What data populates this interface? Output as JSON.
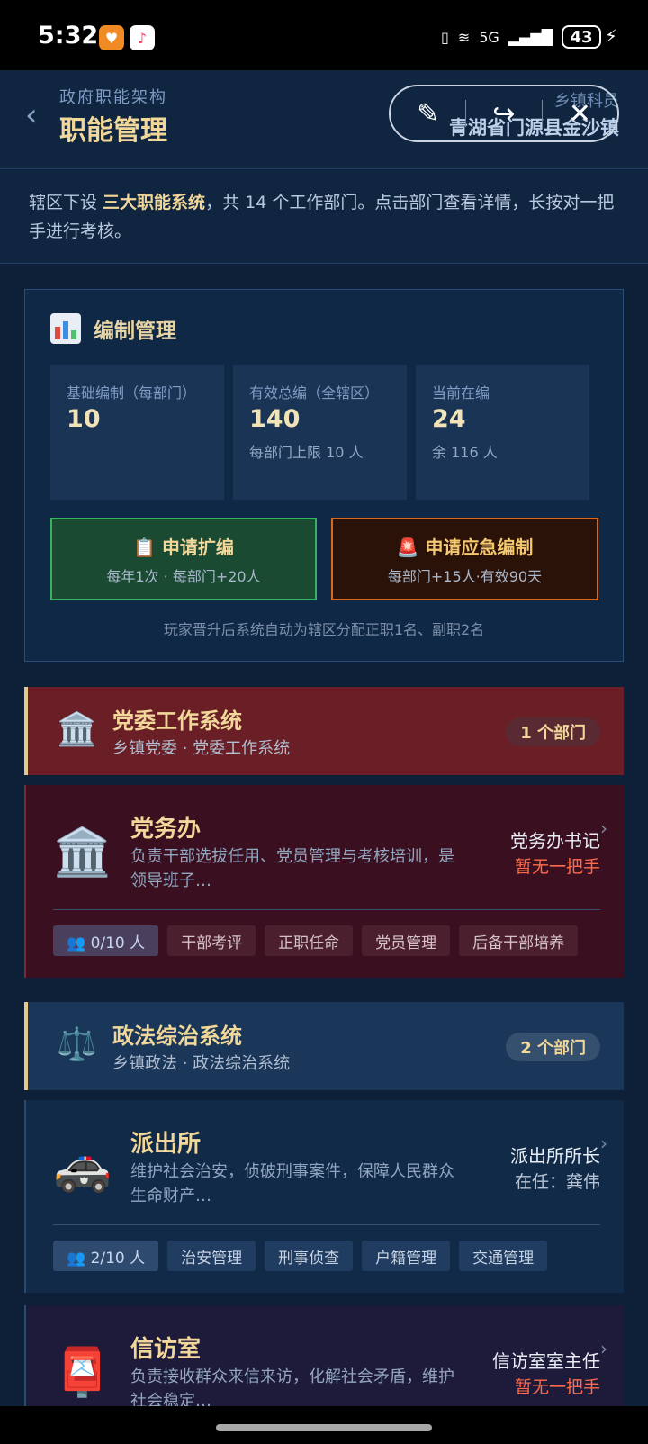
{
  "status_bar": {
    "time": "5:32",
    "network": "5G",
    "battery": "43"
  },
  "header": {
    "subtitle": "政府职能架构",
    "title": "职能管理",
    "right_subtitle": "乡镇科员",
    "right_title": "青湖省门源县金沙镇",
    "back_icon": "chevron-left-icon",
    "pill_icons": [
      "magic-pen-icon",
      "share-icon",
      "close-icon"
    ]
  },
  "intro": {
    "prefix": "辖区下设 ",
    "highlight": "三大职能系统",
    "suffix": "，共 14 个工作部门。点击部门查看详情，长按对一把手进行考核。"
  },
  "staffing": {
    "title": "编制管理",
    "stats": [
      {
        "label": "基础编制（每部门）",
        "value": "10",
        "sub": ""
      },
      {
        "label": "有效总编（全辖区）",
        "value": "140",
        "sub": "每部门上限 10 人"
      },
      {
        "label": "当前在编",
        "value": "24",
        "sub": "余 116 人"
      }
    ],
    "actions": [
      {
        "icon": "📋",
        "title": "申请扩编",
        "desc": "每年1次 · 每部门+20人"
      },
      {
        "icon": "🚨",
        "title": "申请应急编制",
        "desc": "每部门+15人·有效90天"
      }
    ],
    "note": "玩家晋升后系统自动为辖区分配正职1名、副职2名"
  },
  "systems": [
    {
      "icon": "🏛️",
      "name": "党委工作系统",
      "meta": "乡镇党委 · 党委工作系统",
      "count": "1 个部门"
    },
    {
      "icon": "⚖️",
      "name": "政法综治系统",
      "meta": "乡镇政法 · 政法综治系统",
      "count": "2 个部门"
    }
  ],
  "departments": [
    {
      "icon": "🏛️",
      "name": "党务办",
      "desc": "负责干部选拔任用、党员管理与考核培训，是领导班子…",
      "role": "党务办书记",
      "leader": "暂无一把手",
      "people": "👥 0/10 人",
      "tags": [
        "干部考评",
        "正职任命",
        "党员管理",
        "后备干部培养"
      ]
    },
    {
      "icon": "🚓",
      "name": "派出所",
      "desc": "维护社会治安，侦破刑事案件，保障人民群众生命财产…",
      "role": "派出所所长",
      "leader": "在任：龚伟",
      "people": "👥 2/10 人",
      "tags": [
        "治安管理",
        "刑事侦查",
        "户籍管理",
        "交通管理"
      ]
    },
    {
      "icon": "📮",
      "name": "信访室",
      "desc": "负责接收群众来信来访，化解社会矛盾，维护社会稳定…",
      "role": "信访室室主任",
      "leader": "暂无一把手"
    }
  ]
}
